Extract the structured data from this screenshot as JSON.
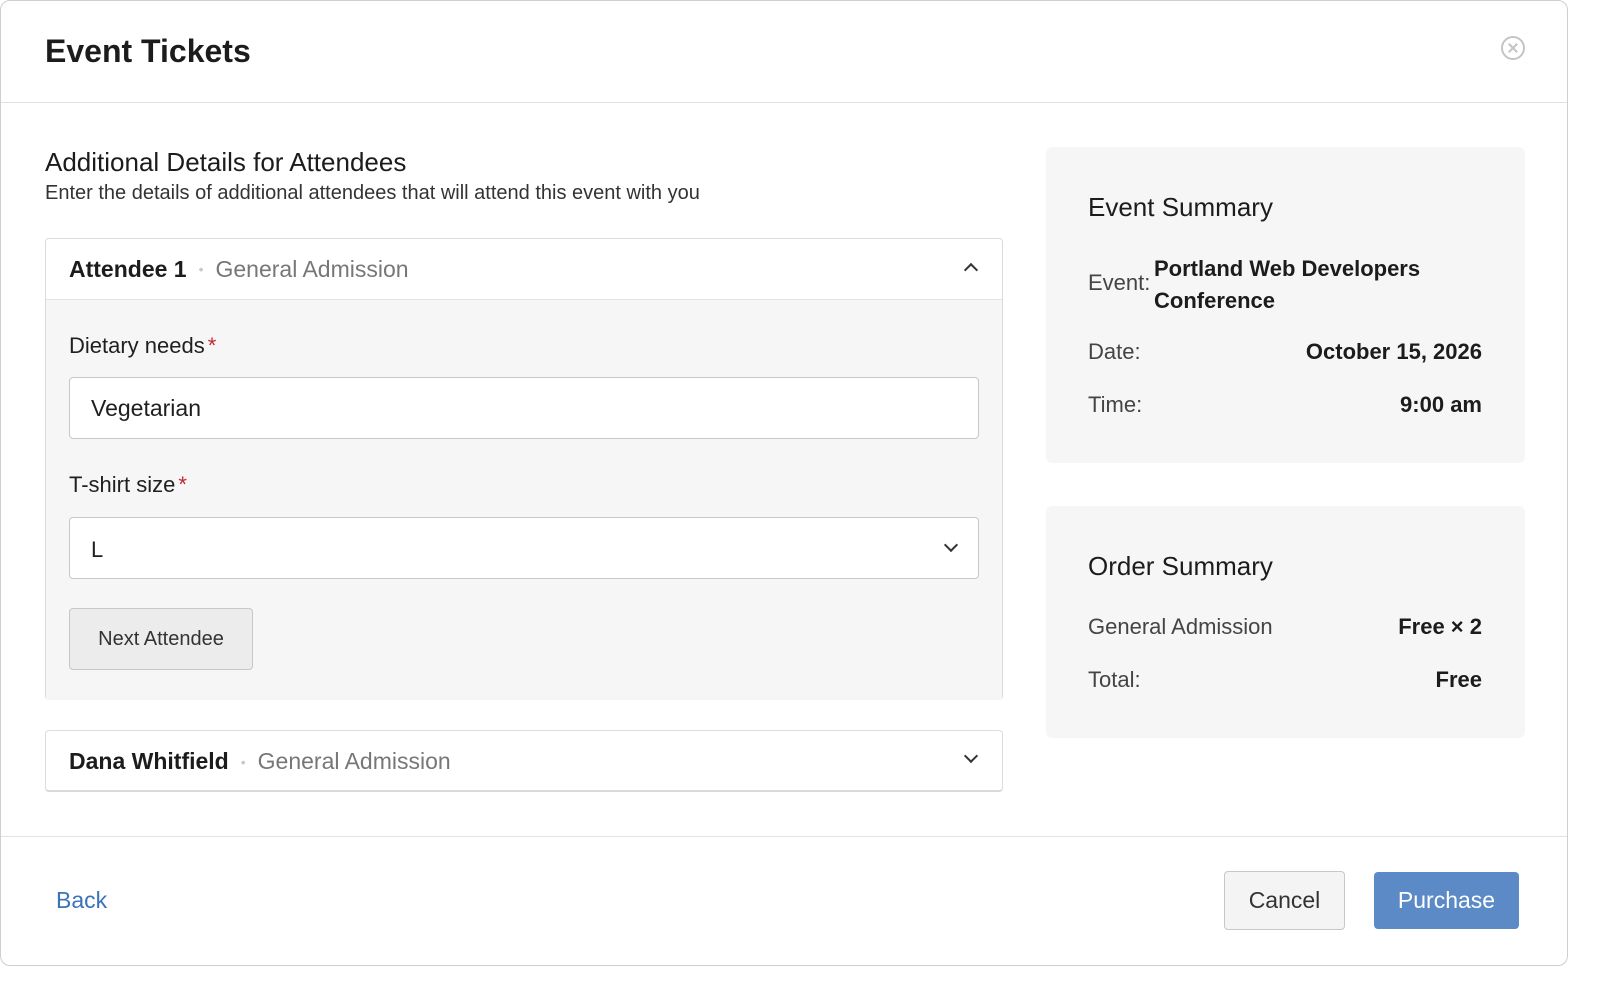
{
  "modal": {
    "title": "Event Tickets"
  },
  "attendees_section": {
    "title": "Additional Details for Attendees",
    "subtitle": "Enter the details of additional attendees that will attend this event with you"
  },
  "attendees": [
    {
      "name": "Attendee 1",
      "ticket_type": "General Admission",
      "expanded": true,
      "fields": {
        "dietary_label": "Dietary needs",
        "dietary_value": "Vegetarian",
        "tshirt_label": "T-shirt size",
        "tshirt_value": "L",
        "required_marker": "*"
      },
      "next_button": "Next Attendee"
    },
    {
      "name": "Dana Whitfield",
      "ticket_type": "General Admission",
      "expanded": false
    }
  ],
  "separator": "•",
  "event_summary": {
    "title": "Event Summary",
    "event_label": "Event:",
    "event_value": "Portland Web Developers Conference",
    "date_label": "Date:",
    "date_value": "October 15, 2026",
    "time_label": "Time:",
    "time_value": "9:00 am"
  },
  "order_summary": {
    "title": "Order Summary",
    "item_label": "General Admission",
    "item_value": "Free × 2",
    "total_label": "Total:",
    "total_value": "Free"
  },
  "footer": {
    "back": "Back",
    "cancel": "Cancel",
    "purchase": "Purchase"
  },
  "colors": {
    "primary": "#5b8ac6",
    "link": "#3a73b8",
    "required": "#c0282d",
    "panel": "#f6f6f6"
  }
}
